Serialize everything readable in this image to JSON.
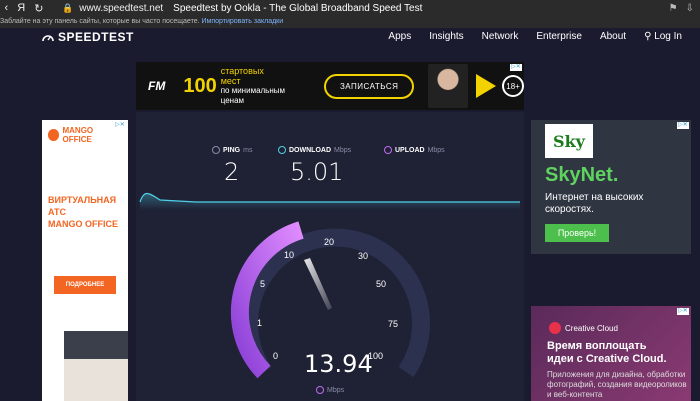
{
  "browser": {
    "nav_icons": [
      "back-icon",
      "yandex-icon",
      "reload-icon"
    ],
    "url": "www.speedtest.net",
    "title": "Speedtest by Ookla - The Global Broadband Speed Test",
    "bookmarks_hint": "Заблайте на эту панель сайты, которые вы часто посещаете.",
    "bookmarks_link": "Импортировать закладки"
  },
  "header": {
    "logo": "SPEEDTEST",
    "nav": [
      "Apps",
      "Insights",
      "Network",
      "Enterprise",
      "About",
      "Log In"
    ]
  },
  "top_banner": {
    "brand": "FM",
    "big": "100",
    "line1": "стартовых",
    "line2": "мест",
    "line3": "по минимальным ценам",
    "cta": "ЗАПИСАТЬСЯ",
    "age": "18+"
  },
  "left_ad": {
    "brand": "MANGO OFFICE",
    "headline1": "ВИРТУАЛЬНАЯ",
    "headline2": "АТС",
    "headline3": "MANGO OFFICE",
    "button": "ПОДРОБНЕЕ"
  },
  "right_ad1": {
    "logo": "Sky",
    "brand": "SkyNet.",
    "text1": "Интернет на высоких",
    "text2": "скоростях.",
    "button": "Проверь!"
  },
  "right_ad2": {
    "brand": "Creative Cloud",
    "h1": "Время воплощать",
    "h2": "идеи с Creative Cloud.",
    "sub": "Приложения для дизайна, обработки фотографий, создания видеороликов и веб-контента"
  },
  "stats": {
    "ping_label": "PING",
    "ping_unit": "ms",
    "ping_value": "2",
    "download_label": "DOWNLOAD",
    "download_unit": "Mbps",
    "download_value": "5.01",
    "upload_label": "UPLOAD",
    "upload_unit": "Mbps"
  },
  "gauge": {
    "ticks": [
      "0",
      "1",
      "5",
      "10",
      "20",
      "30",
      "50",
      "75",
      "100"
    ],
    "current_speed": "13.94",
    "unit": "Mbps",
    "needle_value": 13.94
  },
  "colors": {
    "bg": "#1a1b2e",
    "accent_purple": "#c06cf0",
    "accent_cyan": "#4ed1e8"
  }
}
